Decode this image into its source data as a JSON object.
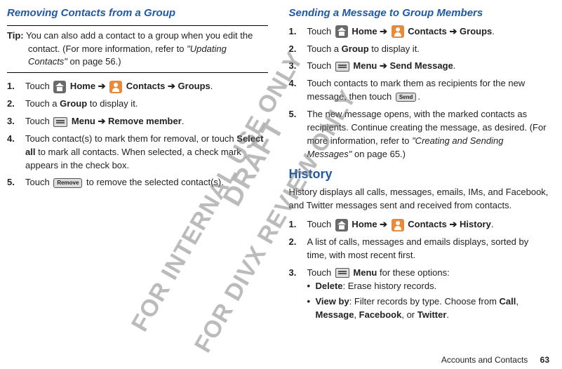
{
  "left": {
    "title": "Removing Contacts from a Group",
    "tip_label": "Tip:",
    "tip_line1": "You can also add a contact to a group when you edit the",
    "tip_line2": "contact. (For more information, refer to ",
    "tip_ref": "\"Updating Contacts\"",
    "tip_line3": " on page 56.)",
    "steps": {
      "s1_a": "Touch ",
      "s1_home": " Home ➔ ",
      "s1_contacts": " Contacts ➔ Groups",
      "s1_end": ".",
      "s2_a": "Touch a ",
      "s2_b": "Group",
      "s2_c": " to display it.",
      "s3_a": "Touch ",
      "s3_b": " Menu ➔ Remove member",
      "s3_c": ".",
      "s4_a": "Touch contact(s) to mark them for removal, or touch ",
      "s4_b": "Select all",
      "s4_c": " to mark all contacts. When selected, a check mark appears in the check box.",
      "s5_a": "Touch ",
      "s5_btn": "Remove",
      "s5_b": " to remove the selected contact(s)."
    }
  },
  "right": {
    "title": "Sending a Message to Group Members",
    "steps": {
      "s1_a": "Touch ",
      "s1_home": " Home ➔ ",
      "s1_contacts": " Contacts ➔ Groups",
      "s1_end": ".",
      "s2_a": "Touch a ",
      "s2_b": "Group",
      "s2_c": " to display it.",
      "s3_a": "Touch ",
      "s3_b": " Menu ➔ Send Message",
      "s3_c": ".",
      "s4_a": "Touch contacts to mark them as recipients for the new message, then touch ",
      "s4_btn": "Send",
      "s4_b": ".",
      "s5_a": "The new message opens, with the marked contacts as recipients. Continue creating the message, as desired. (For more information, refer to ",
      "s5_ref": "\"Creating and Sending Messages\"",
      "s5_b": " on page 65.)"
    },
    "history_title": "History",
    "history_para": "History displays all calls, messages, emails, IMs, and Facebook, and Twitter messages sent and received from contacts.",
    "hsteps": {
      "s1_a": "Touch ",
      "s1_home": " Home ➔ ",
      "s1_contacts": " Contacts ➔ History",
      "s1_end": ".",
      "s2": "A list of calls, messages and emails displays, sorted by time, with most recent first.",
      "s3_a": "Touch ",
      "s3_b": " Menu",
      "s3_c": " for these options:",
      "b1_a": "Delete",
      "b1_b": ": Erase history records.",
      "b2_a": "View by",
      "b2_b": ": Filter records by type. Choose from ",
      "b2_c": "Call",
      "b2_d": ", ",
      "b2_e": "Message",
      "b2_f": ", ",
      "b2_g": "Facebook",
      "b2_h": ", or ",
      "b2_i": "Twitter",
      "b2_j": "."
    }
  },
  "footer": {
    "section": "Accounts and Contacts",
    "page": "63"
  },
  "watermarks": {
    "draft": "DRAFT",
    "internal": "FOR INTERNAL USE ONLY",
    "divx": "FOR DIVX REVIEW ONLY"
  }
}
